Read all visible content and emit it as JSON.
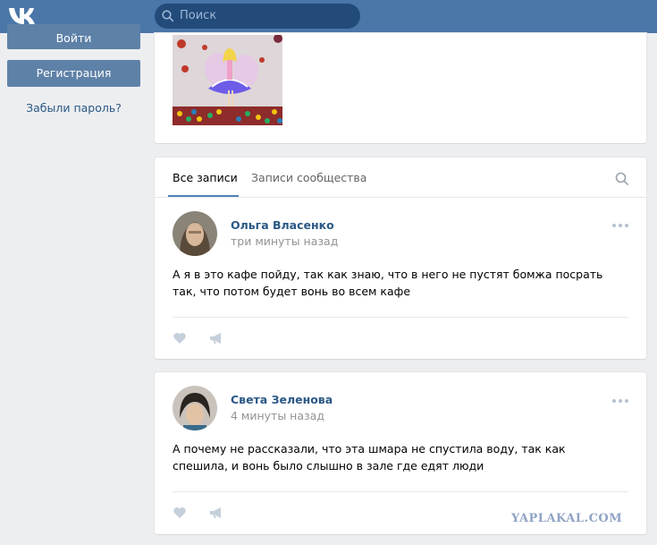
{
  "header": {
    "logo_icon": "vk-logo-icon",
    "search_placeholder": "Поиск"
  },
  "sidebar": {
    "login_label": "Войти",
    "register_label": "Регистрация",
    "forgot_label": "Забыли пароль?"
  },
  "feed": {
    "tabs": [
      {
        "label": "Все записи",
        "active": true
      },
      {
        "label": "Записи сообщества",
        "active": false
      }
    ]
  },
  "posts": [
    {
      "author": "Ольга Власенко",
      "time": "три минуты назад",
      "text": "А я в это кафе пойду, так как знаю, что в него не пустят бомжа посрать так, что потом будет вонь во всем кафе"
    },
    {
      "author": "Света Зеленова",
      "time": "4 минуты назад",
      "text": "А почему не рассказали, что эта шмара не спустила воду, так как спешила, и вонь было слышно в зале где едят люди"
    }
  ],
  "watermark": "YAPLAKAL.COM",
  "colors": {
    "header": "#4a76a8",
    "link": "#2a5885",
    "button": "#5e81a8",
    "tab_underline": "#5181b8"
  }
}
